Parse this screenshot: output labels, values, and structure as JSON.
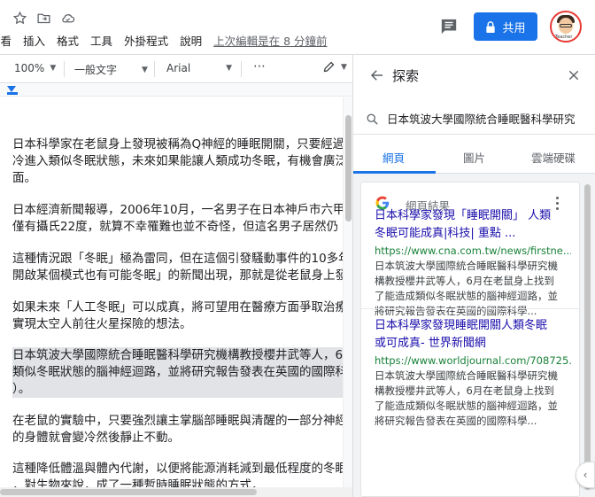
{
  "header": {
    "menus": [
      "查看",
      "插入",
      "格式",
      "工具",
      "外掛程式",
      "說明"
    ],
    "last_edit": "上次編輯是在 8 分鐘前",
    "share_label": "共用",
    "avatar_tag": "Teacher"
  },
  "toolbar": {
    "zoom": "100%",
    "style": "一般文字",
    "font": "Arial",
    "more": "⋯"
  },
  "document": {
    "paragraphs": [
      {
        "lines": [
          "日本科學家在老鼠身上發現被稱為Q神經的睡眠開關，只要經過",
          "冷進入類似冬眠狀態，未來如果能讓人類成功冬眠，有機會廣泛",
          "面。"
        ],
        "highlight": false
      },
      {
        "lines": [
          "日本經濟新聞報導，2006年10月，一名男子在日本神戶市六甲",
          "僅有攝氏22度，就算不幸罹難也並不奇怪，但這名男子居然仍"
        ],
        "highlight": false
      },
      {
        "lines": [
          "這種情況跟「冬眠」極為雷同，但在這個引發騷動事件的10多年",
          "開啟某個模式也有可能冬眠」的新聞出現，那就是從老鼠身上發"
        ],
        "highlight": false
      },
      {
        "lines": [
          "如果未來「人工冬眠」可以成真，將可望用在醫療方面爭取治療",
          "實現太空人前往火星探險的想法。"
        ],
        "highlight": false
      },
      {
        "lines": [
          "日本筑波大學國際統合睡眠醫科學研究機構教授櫻井武等人，6",
          "類似冬眠狀態的腦神經迴路，並將研究報告發表在英國的國際科",
          "）。"
        ],
        "highlight": true
      },
      {
        "lines": [
          "在老鼠的實驗中，只要強烈讓主掌腦部睡眠與清醒的一部分神經",
          "的身體就會變冷然後靜止不動。"
        ],
        "highlight": false
      },
      {
        "lines": [
          "這種降低體溫與體內代謝，以便將能源消耗減到最低程度的冬眠",
          "，對生物來說，成了一種暫時睡眠狀態的方式，"
        ],
        "highlight": false
      }
    ]
  },
  "explore": {
    "title": "探索",
    "query": "日本筑波大學國際統合睡眠醫科學研究",
    "tabs": [
      "網頁",
      "圖片",
      "雲端硬碟"
    ],
    "active_tab": 0,
    "card_label": "網頁結果",
    "results": [
      {
        "title_lines": [
          "日本科學家發現「睡眠開關」 人類",
          "冬眠可能成真|科技| 重點 ..."
        ],
        "url": "https://www.cna.com.tw/news/firstne...",
        "snippet_lines": [
          "日本筑波大學國際統合睡眠醫科學研究機",
          "構教授櫻井武等人，6月在老鼠身上找到",
          "了能造成類似冬眠狀態的腦神經迴路，並",
          "將研究報告發表在英國的國際科學..."
        ]
      },
      {
        "title_lines": [
          "日本科學家發現睡眠開關人類冬眠",
          "或可成真- 世界新聞網"
        ],
        "url": "https://www.worldjournal.com/708725...",
        "snippet_lines": [
          "日本筑波大學國際統合睡眠醫科學研究機",
          "構教授櫻井武等人，6月在老鼠身上找到",
          "了能造成類似冬眠狀態的腦神經迴路，並",
          "將研究報告發表在英國的國際科學..."
        ]
      }
    ]
  },
  "colors": {
    "accent": "#1a73e8",
    "link": "#1a0dab",
    "url": "#188038",
    "highlight": "#e1e3e6"
  },
  "icons": [
    "star-icon",
    "move-folder-icon",
    "cloud-status-icon",
    "comment-icon",
    "lock-icon",
    "back-arrow-icon",
    "close-icon",
    "search-icon",
    "google-logo-icon",
    "more-vert-icon",
    "pen-icon",
    "chevron-left-icon"
  ]
}
